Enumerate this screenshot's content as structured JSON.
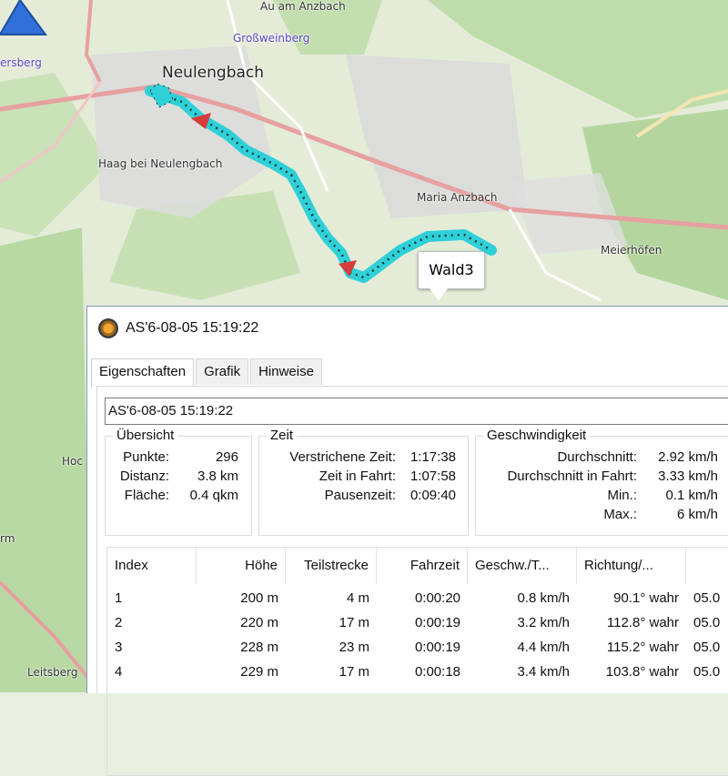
{
  "map": {
    "places": [
      {
        "name": "Au am Anzbach",
        "style": "normal"
      },
      {
        "name": "Großweinberg",
        "style": "purple"
      },
      {
        "name": "ersberg",
        "style": "purple"
      },
      {
        "name": "Neulengbach",
        "style": "big"
      },
      {
        "name": "Haag bei Neulengbach",
        "style": "normal"
      },
      {
        "name": "Maria Anzbach",
        "style": "normal"
      },
      {
        "name": "Meierhöfen",
        "style": "normal"
      },
      {
        "name": "Hoc",
        "style": "normal"
      },
      {
        "name": "rm",
        "style": "normal"
      },
      {
        "name": "Leitsberg",
        "style": "normal"
      }
    ],
    "track_color": "#2fd0d8",
    "waypoint_label": "Wald3"
  },
  "window": {
    "title": "AS'6-08-05 15:19:22",
    "tabs": [
      "Eigenschaften",
      "Grafik",
      "Hinweise"
    ],
    "active_tab": "Eigenschaften",
    "name_value": "AS'6-08-05 15:19:22",
    "overview": {
      "legend": "Übersicht",
      "rows": [
        {
          "label": "Punkte:",
          "value": "296"
        },
        {
          "label": "Distanz:",
          "value": "3.8 km"
        },
        {
          "label": "Fläche:",
          "value": "0.4 qkm"
        }
      ]
    },
    "time": {
      "legend": "Zeit",
      "rows": [
        {
          "label": "Verstrichene Zeit:",
          "value": "1:17:38"
        },
        {
          "label": "Zeit in Fahrt:",
          "value": "1:07:58"
        },
        {
          "label": "Pausenzeit:",
          "value": "0:09:40"
        }
      ]
    },
    "speed": {
      "legend": "Geschwindigkeit",
      "rows": [
        {
          "label": "Durchschnitt:",
          "value": "2.92 km/h"
        },
        {
          "label": "Durchschnitt in Fahrt:",
          "value": "3.33 km/h"
        },
        {
          "label": "Min.:",
          "value": "0.1 km/h"
        },
        {
          "label": "Max.:",
          "value": "6 km/h"
        }
      ]
    },
    "table": {
      "columns": [
        "Index",
        "Höhe",
        "Teilstrecke",
        "Fahrzeit",
        "Geschw./T...",
        "Richtung/...",
        ""
      ],
      "rows": [
        [
          "1",
          "200 m",
          "4 m",
          "0:00:20",
          "0.8 km/h",
          "90.1° wahr",
          "05.0"
        ],
        [
          "2",
          "220 m",
          "17 m",
          "0:00:19",
          "3.2 km/h",
          "112.8° wahr",
          "05.0"
        ],
        [
          "3",
          "228 m",
          "23 m",
          "0:00:19",
          "4.4 km/h",
          "115.2° wahr",
          "05.0"
        ],
        [
          "4",
          "229 m",
          "17 m",
          "0:00:18",
          "3.4 km/h",
          "103.8° wahr",
          "05.0"
        ]
      ]
    }
  }
}
